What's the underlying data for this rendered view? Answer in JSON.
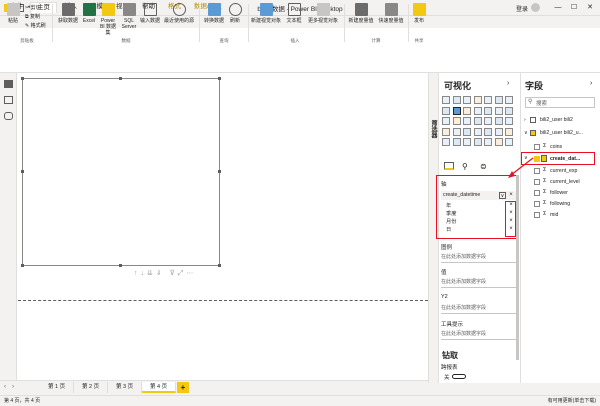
{
  "titlebar": {
    "title": "bili站数据 - Power BI Desktop",
    "signin": "登录",
    "min": "—",
    "max": "☐",
    "close": "✕"
  },
  "tabs": [
    "文件",
    "主页",
    "插入",
    "建模",
    "视图",
    "帮助",
    "格式",
    "数据/钻取"
  ],
  "ribbon": {
    "paste": "粘贴",
    "cut": "剪切",
    "copy": "复制",
    "format_painter": "格式刷",
    "clipboard_group": "剪贴板",
    "get_data": "获取数据",
    "excel": "Excel",
    "pbi_datasets": "Power BI 数据集",
    "sql_server": "SQL Server",
    "enter_data": "输入数据",
    "recent_sources": "最近使用的源",
    "data_group": "数据",
    "transform": "转换数据",
    "refresh": "刷新",
    "queries_group": "查询",
    "new_visual": "新建视觉对象",
    "text_box": "文本框",
    "more_visuals": "更多视觉对象",
    "insert_group": "插入",
    "new_measure": "新建度量值",
    "quick_measure": "快速度量值",
    "calc_group": "计算",
    "publish": "发布",
    "share_group": "共享"
  },
  "pages": [
    "第 1 页",
    "第 2 页",
    "第 3 页",
    "第 4 页"
  ],
  "add_page": "+",
  "status": {
    "left": "第 4 页，共 4 页",
    "right": "有可用更新(单击下载)"
  },
  "filter_label": "筛选器",
  "viz": {
    "title": "可视化",
    "axis_label": "轴",
    "axis_field": "create_datetime",
    "hierarchy": [
      "年",
      "季度",
      "月份",
      "日"
    ],
    "legend_label": "图例",
    "legend_placeholder": "在此处添加数据字段",
    "values_label": "值",
    "values_placeholder": "在此处添加数据字段",
    "y2_label": "Y2",
    "y2_placeholder": "在此处添加数据字段",
    "tooltips_label": "工具提示",
    "tooltips_placeholder": "在此处添加数据字段",
    "drill_title": "钻取",
    "cross_report": "跨报表",
    "toggle_off": "关"
  },
  "fields": {
    "title": "字段",
    "search_placeholder": "搜索",
    "tables": [
      "bili2_user bili2",
      "bili2_user bili2_u..."
    ],
    "columns": [
      "coins",
      "create_dat...",
      "current_exp",
      "current_level",
      "follower",
      "following",
      "mid"
    ],
    "sigma": "Σ"
  },
  "colors": {
    "accent": "#f2c811",
    "highlight": "#e81123"
  }
}
